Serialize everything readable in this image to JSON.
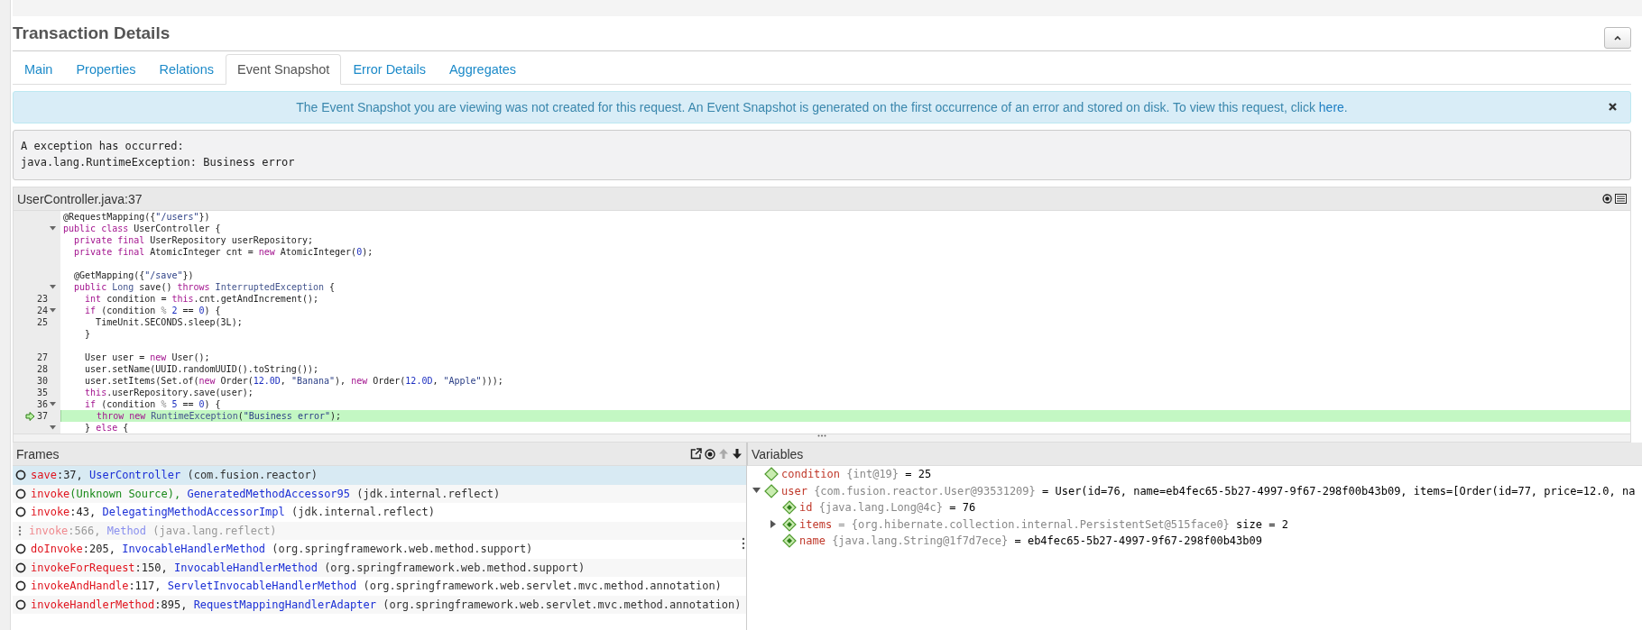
{
  "title": "Transaction Details",
  "tabs": [
    {
      "label": "Main",
      "selected": false
    },
    {
      "label": "Properties",
      "selected": false
    },
    {
      "label": "Relations",
      "selected": false
    },
    {
      "label": "Event Snapshot",
      "selected": true
    },
    {
      "label": "Error Details",
      "selected": false
    },
    {
      "label": "Aggregates",
      "selected": false
    }
  ],
  "notice": {
    "text": "The Event Snapshot you are viewing was not created for this request. An Event Snapshot is generated on the first occurrence of an error and stored on disk. To view this request, click ",
    "link": "here",
    "after": "."
  },
  "exception": [
    "A exception has occurred:",
    "java.lang.RuntimeException: Business error"
  ],
  "code": {
    "title": "UserController.java:37",
    "lines": [
      {
        "kind": "code",
        "tokens": [
          {
            "kind": "plain",
            "text": "@RequestMapping({"
          },
          {
            "kind": "string",
            "text": "\"/users\""
          },
          {
            "kind": "plain",
            "text": "})"
          }
        ]
      },
      {
        "kind": "code",
        "expanded": true,
        "tokens": [
          {
            "kind": "keyword",
            "text": "public class"
          },
          {
            "kind": "plain",
            "text": " UserController {"
          }
        ]
      },
      {
        "kind": "code",
        "tokens": [
          {
            "kind": "keyword",
            "text": "  private final"
          },
          {
            "kind": "plain",
            "text": " UserRepository userRepository;"
          }
        ]
      },
      {
        "kind": "code",
        "tokens": [
          {
            "kind": "keyword",
            "text": "  private final"
          },
          {
            "kind": "plain",
            "text": " AtomicInteger cnt = "
          },
          {
            "kind": "keyword",
            "text": "new"
          },
          {
            "kind": "plain",
            "text": " AtomicInteger("
          },
          {
            "kind": "number",
            "text": "0"
          },
          {
            "kind": "plain",
            "text": ");"
          }
        ]
      },
      {
        "kind": "blank"
      },
      {
        "kind": "code",
        "tokens": [
          {
            "kind": "plain",
            "text": "  @GetMapping({"
          },
          {
            "kind": "string",
            "text": "\"/save\""
          },
          {
            "kind": "plain",
            "text": "})"
          }
        ]
      },
      {
        "kind": "code",
        "expanded": true,
        "tokens": [
          {
            "kind": "keyword",
            "text": "  public "
          },
          {
            "kind": "type",
            "text": "Long"
          },
          {
            "kind": "plain",
            "text": " save() "
          },
          {
            "kind": "keyword",
            "text": "throws "
          },
          {
            "kind": "type",
            "text": "InterruptedException"
          },
          {
            "kind": "plain",
            "text": " {"
          }
        ]
      },
      {
        "kind": "code",
        "number": "23",
        "tokens": [
          {
            "kind": "keyword",
            "text": "    int"
          },
          {
            "kind": "plain",
            "text": " condition = "
          },
          {
            "kind": "keyword",
            "text": "this"
          },
          {
            "kind": "plain",
            "text": ".cnt.getAndIncrement();"
          }
        ]
      },
      {
        "kind": "code",
        "number": "24",
        "expanded": true,
        "tokens": [
          {
            "kind": "keyword",
            "text": "    if"
          },
          {
            "kind": "plain",
            "text": " (condition "
          },
          {
            "kind": "operator",
            "text": "%"
          },
          {
            "kind": "number",
            "text": " 2"
          },
          {
            "kind": "plain",
            "text": " == "
          },
          {
            "kind": "number",
            "text": "0"
          },
          {
            "kind": "plain",
            "text": ") {"
          }
        ]
      },
      {
        "kind": "code",
        "number": "25",
        "tokens": [
          {
            "kind": "plain",
            "text": "      TimeUnit.SECONDS.sleep(3L);"
          }
        ]
      },
      {
        "kind": "code",
        "tokens": [
          {
            "kind": "plain",
            "text": "    }"
          }
        ]
      },
      {
        "kind": "blank"
      },
      {
        "kind": "code",
        "number": "27",
        "tokens": [
          {
            "kind": "plain",
            "text": "    User user = "
          },
          {
            "kind": "keyword",
            "text": "new"
          },
          {
            "kind": "plain",
            "text": " User();"
          }
        ]
      },
      {
        "kind": "code",
        "number": "28",
        "tokens": [
          {
            "kind": "plain",
            "text": "    user.setName(UUID.randomUUID().toString());"
          }
        ]
      },
      {
        "kind": "code",
        "number": "30",
        "tokens": [
          {
            "kind": "plain",
            "text": "    user.setItems(Set.of("
          },
          {
            "kind": "keyword",
            "text": "new"
          },
          {
            "kind": "plain",
            "text": " Order("
          },
          {
            "kind": "number",
            "text": "12.0D"
          },
          {
            "kind": "plain",
            "text": ", "
          },
          {
            "kind": "string",
            "text": "\"Banana\""
          },
          {
            "kind": "plain",
            "text": "), "
          },
          {
            "kind": "keyword",
            "text": "new"
          },
          {
            "kind": "plain",
            "text": " Order("
          },
          {
            "kind": "number",
            "text": "12.0D"
          },
          {
            "kind": "plain",
            "text": ", "
          },
          {
            "kind": "string",
            "text": "\"Apple\""
          },
          {
            "kind": "plain",
            "text": ")));"
          }
        ]
      },
      {
        "kind": "code",
        "number": "35",
        "tokens": [
          {
            "kind": "keyword",
            "text": "    this"
          },
          {
            "kind": "plain",
            "text": ".userRepository.save(user);"
          }
        ]
      },
      {
        "kind": "code",
        "number": "36",
        "expanded": true,
        "tokens": [
          {
            "kind": "keyword",
            "text": "    if"
          },
          {
            "kind": "plain",
            "text": " (condition "
          },
          {
            "kind": "operator",
            "text": "%"
          },
          {
            "kind": "number",
            "text": " 5"
          },
          {
            "kind": "plain",
            "text": " == "
          },
          {
            "kind": "number",
            "text": "0"
          },
          {
            "kind": "plain",
            "text": ") {"
          }
        ]
      },
      {
        "kind": "code",
        "number": "37",
        "current": true,
        "tokens": [
          {
            "kind": "keyword",
            "text": "      throw new "
          },
          {
            "kind": "type",
            "text": "RuntimeException"
          },
          {
            "kind": "plain",
            "text": "("
          },
          {
            "kind": "string",
            "text": "\"Business error\""
          },
          {
            "kind": "plain",
            "text": ");"
          }
        ]
      },
      {
        "kind": "code",
        "expanded": true,
        "tokens": [
          {
            "kind": "plain",
            "text": "    } "
          },
          {
            "kind": "keyword",
            "text": "else"
          },
          {
            "kind": "plain",
            "text": " {"
          }
        ]
      }
    ]
  },
  "frames": {
    "title": "Frames",
    "rows": [
      {
        "kind": "frame",
        "selected": true,
        "method": "save",
        "location": ":37,",
        "location_known": true,
        "class": "UserController",
        "package": "(com.fusion.reactor)"
      },
      {
        "kind": "frame",
        "selected": false,
        "method": "invoke",
        "location": "(Unknown Source),",
        "location_known": false,
        "class": "GeneratedMethodAccessor95",
        "package": "(jdk.internal.reflect)"
      },
      {
        "kind": "frame",
        "selected": false,
        "method": "invoke",
        "location": ":43,",
        "location_known": true,
        "class": "DelegatingMethodAccessorImpl",
        "package": "(jdk.internal.reflect)"
      },
      {
        "kind": "hidden",
        "selected": false,
        "method": "invoke",
        "location": ":566,",
        "location_known": true,
        "class": "Method",
        "package": "(java.lang.reflect)"
      },
      {
        "kind": "frame",
        "selected": false,
        "method": "doInvoke",
        "location": ":205,",
        "location_known": true,
        "class": "InvocableHandlerMethod",
        "package": "(org.springframework.web.method.support)"
      },
      {
        "kind": "frame",
        "selected": false,
        "method": "invokeForRequest",
        "location": ":150,",
        "location_known": true,
        "class": "InvocableHandlerMethod",
        "package": "(org.springframework.web.method.support)"
      },
      {
        "kind": "frame",
        "selected": false,
        "method": "invokeAndHandle",
        "location": ":117,",
        "location_known": true,
        "class": "ServletInvocableHandlerMethod",
        "package": "(org.springframework.web.servlet.mvc.method.annotation)"
      },
      {
        "kind": "frame",
        "selected": false,
        "method": "invokeHandlerMethod",
        "location": ":895,",
        "location_known": true,
        "class": "RequestMappingHandlerAdapter",
        "package": "(org.springframework.web.servlet.mvc.method.annotation)"
      }
    ]
  },
  "variables": {
    "title": "Variables",
    "items": [
      {
        "kind": "local",
        "name": "condition",
        "type": "{int@19}",
        "value": "= 25"
      },
      {
        "kind": "local",
        "name": "user",
        "type": "{com.fusion.reactor.User@93531209}",
        "value": "= User(id=76, name=eb4fec65-5b27-4997-9f67-298f00b43b09, items=[Order(id=77, price=12.0, na",
        "expanded": true,
        "children": [
          {
            "kind": "field",
            "name": "id",
            "type": "{java.lang.Long@4c}",
            "value": "= 76"
          },
          {
            "kind": "field",
            "name": "items",
            "type": "= {org.hibernate.collection.internal.PersistentSet@515face0}",
            "value": "size = 2",
            "expanded": false
          },
          {
            "kind": "field",
            "name": "name",
            "type": "{java.lang.String@1f7d7ece}",
            "value": "= eb4fec65-5b27-4997-9f67-298f00b43b09"
          }
        ]
      }
    ]
  }
}
